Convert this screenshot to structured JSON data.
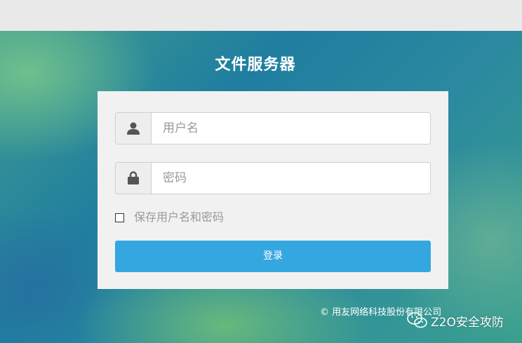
{
  "header": {
    "title": "文件服务器"
  },
  "login": {
    "username_placeholder": "用户名",
    "username_icon": "user-icon",
    "password_placeholder": "密码",
    "password_icon": "lock-icon",
    "remember_label": "保存用户名和密码",
    "remember_checked": false,
    "submit_label": "登录"
  },
  "footer": {
    "copyright": "© 用友网络科技股份有限公司",
    "watermark": "Z2O安全攻防"
  },
  "colors": {
    "accent": "#35a7e0",
    "panel": "#f1f1f1",
    "top_bar": "#e9e9e9"
  }
}
